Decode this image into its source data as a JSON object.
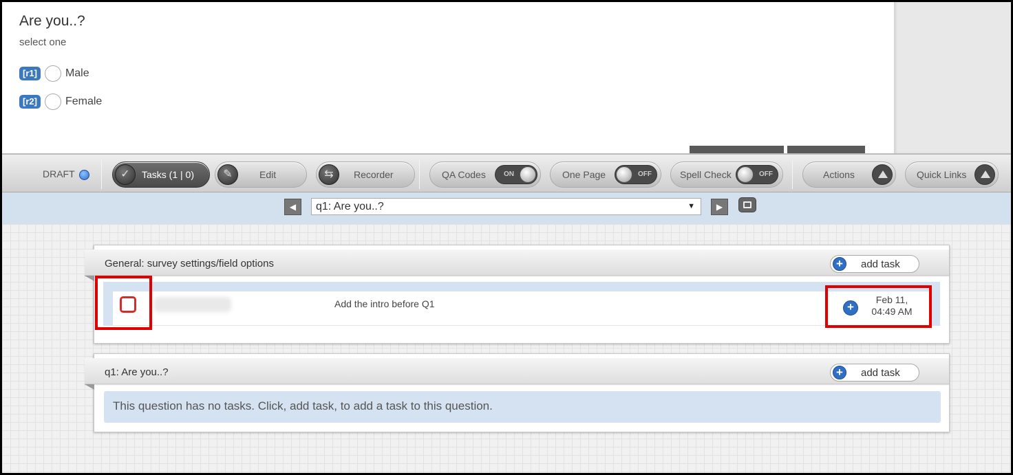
{
  "preview": {
    "question_title": "Are you..?",
    "instruction": "select one",
    "options": [
      {
        "code": "[r1]",
        "label": "Male"
      },
      {
        "code": "[r2]",
        "label": "Female"
      }
    ]
  },
  "toolbar": {
    "status": "DRAFT",
    "tasks_label": "Tasks (1 | 0)",
    "edit_label": "Edit",
    "recorder_label": "Recorder",
    "qa_codes": {
      "label": "QA Codes",
      "state": "ON"
    },
    "one_page": {
      "label": "One Page",
      "state": "OFF"
    },
    "spell_check": {
      "label": "Spell Check",
      "state": "OFF"
    },
    "actions_label": "Actions",
    "quick_links_label": "Quick Links"
  },
  "nav": {
    "selected_question": "q1: Are you..?"
  },
  "panels": [
    {
      "title": "General: survey settings/field options",
      "add_task_label": "add task",
      "tasks": [
        {
          "description": "Add the intro before Q1",
          "date_line1": "Feb 11,",
          "date_line2": "04:49 AM"
        }
      ]
    },
    {
      "title": "q1: Are you..?",
      "add_task_label": "add task",
      "empty_message": "This question has no tasks. Click, add task, to add a task to this question."
    }
  ],
  "colors": {
    "accent_blue": "#3a78c0",
    "highlight_red": "#e00000",
    "nav_bar": "#d3e1ef"
  }
}
